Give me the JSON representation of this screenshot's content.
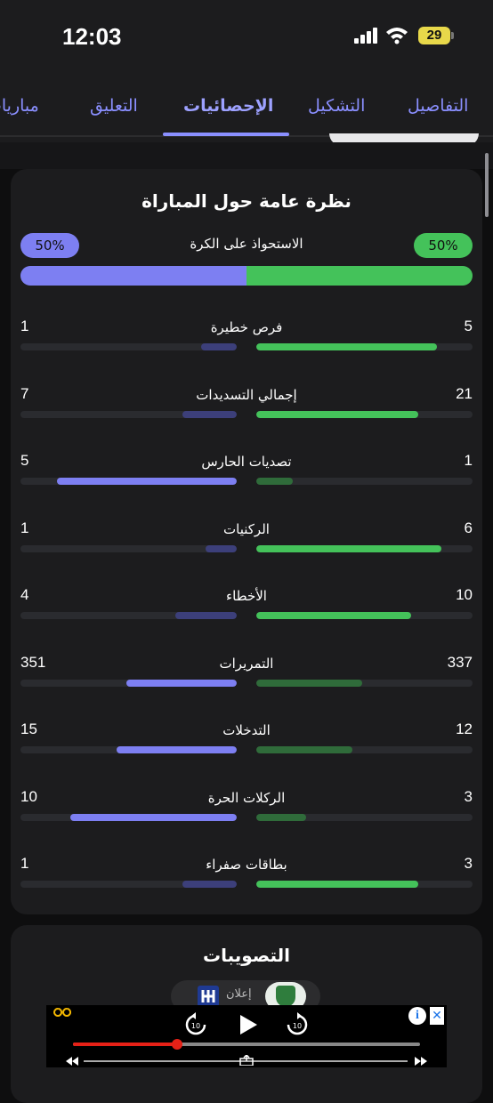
{
  "status_bar": {
    "time": "12:03",
    "battery": "29"
  },
  "tabs": [
    {
      "label": "التفاصيل",
      "active": false
    },
    {
      "label": "التشكيل",
      "active": false
    },
    {
      "label": "الإحصائيات",
      "active": true
    },
    {
      "label": "التعليق",
      "active": false
    },
    {
      "label": "مباريات",
      "active": false
    }
  ],
  "overview": {
    "title": "نظرة عامة حول المباراة",
    "possession": {
      "label": "الاستحواذ على الكرة",
      "home": "50%",
      "away": "50%",
      "home_value": 50,
      "away_value": 50
    },
    "stats": [
      {
        "name": "فرص خطيرة",
        "home": "5",
        "away": "1",
        "home_value": 5,
        "away_value": 1
      },
      {
        "name": "إجمالي التسديدات",
        "home": "21",
        "away": "7",
        "home_value": 21,
        "away_value": 7
      },
      {
        "name": "تصديات الحارس",
        "home": "1",
        "away": "5",
        "home_value": 1,
        "away_value": 5
      },
      {
        "name": "الركنيات",
        "home": "6",
        "away": "1",
        "home_value": 6,
        "away_value": 1
      },
      {
        "name": "الأخطاء",
        "home": "10",
        "away": "4",
        "home_value": 10,
        "away_value": 4
      },
      {
        "name": "التمريرات",
        "home": "337",
        "away": "351",
        "home_value": 337,
        "away_value": 351
      },
      {
        "name": "التدخلات",
        "home": "12",
        "away": "15",
        "home_value": 12,
        "away_value": 15
      },
      {
        "name": "الركلات الحرة",
        "home": "3",
        "away": "10",
        "home_value": 3,
        "away_value": 10
      },
      {
        "name": "بطاقات صفراء",
        "home": "3",
        "away": "1",
        "home_value": 3,
        "away_value": 1
      }
    ]
  },
  "shots": {
    "title": "التصويبات",
    "badge": "إعلان"
  },
  "colors": {
    "home_strong": "#44c25a",
    "home_weak": "#2f6b3a",
    "away_strong": "#7d7ff2",
    "away_weak": "#3c3f7a",
    "accent": "#8a8fff"
  },
  "ad": {
    "info_label": "i",
    "close_label": "✕",
    "progress": 0.3
  }
}
